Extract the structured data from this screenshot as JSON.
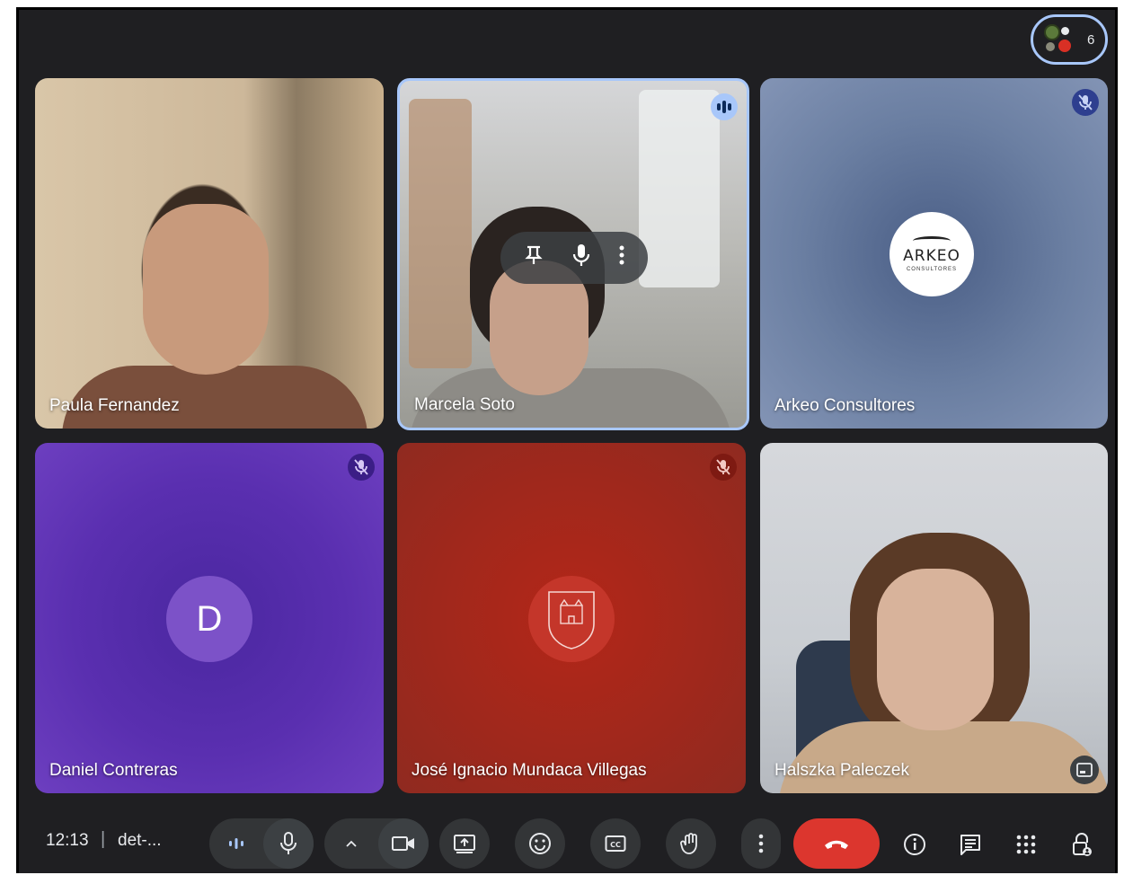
{
  "participants": {
    "count": "6",
    "icon": "people-icon"
  },
  "tiles": [
    {
      "name": "Paula Fernandez"
    },
    {
      "name": "Marcela Soto",
      "status": "speaking"
    },
    {
      "name": "Arkeo Consultores",
      "logo_text": "ARKEO",
      "logo_subtext": "CONSULTORES",
      "muted": true
    },
    {
      "name": "Daniel Contreras",
      "initial": "D",
      "muted": true
    },
    {
      "name": "José Ignacio Mundaca Villegas",
      "muted": true
    },
    {
      "name": "Halszka Paleczek"
    }
  ],
  "hover_controls": [
    "pin-icon",
    "mic-icon",
    "more-vert-icon"
  ],
  "footer": {
    "time": "12:13",
    "separator": "|",
    "meeting_code": "det-..."
  },
  "colors": {
    "background": "#1f1f22",
    "active_border": "#a8c7fa",
    "end_call": "#dc362e",
    "button_bg": "#333537"
  }
}
